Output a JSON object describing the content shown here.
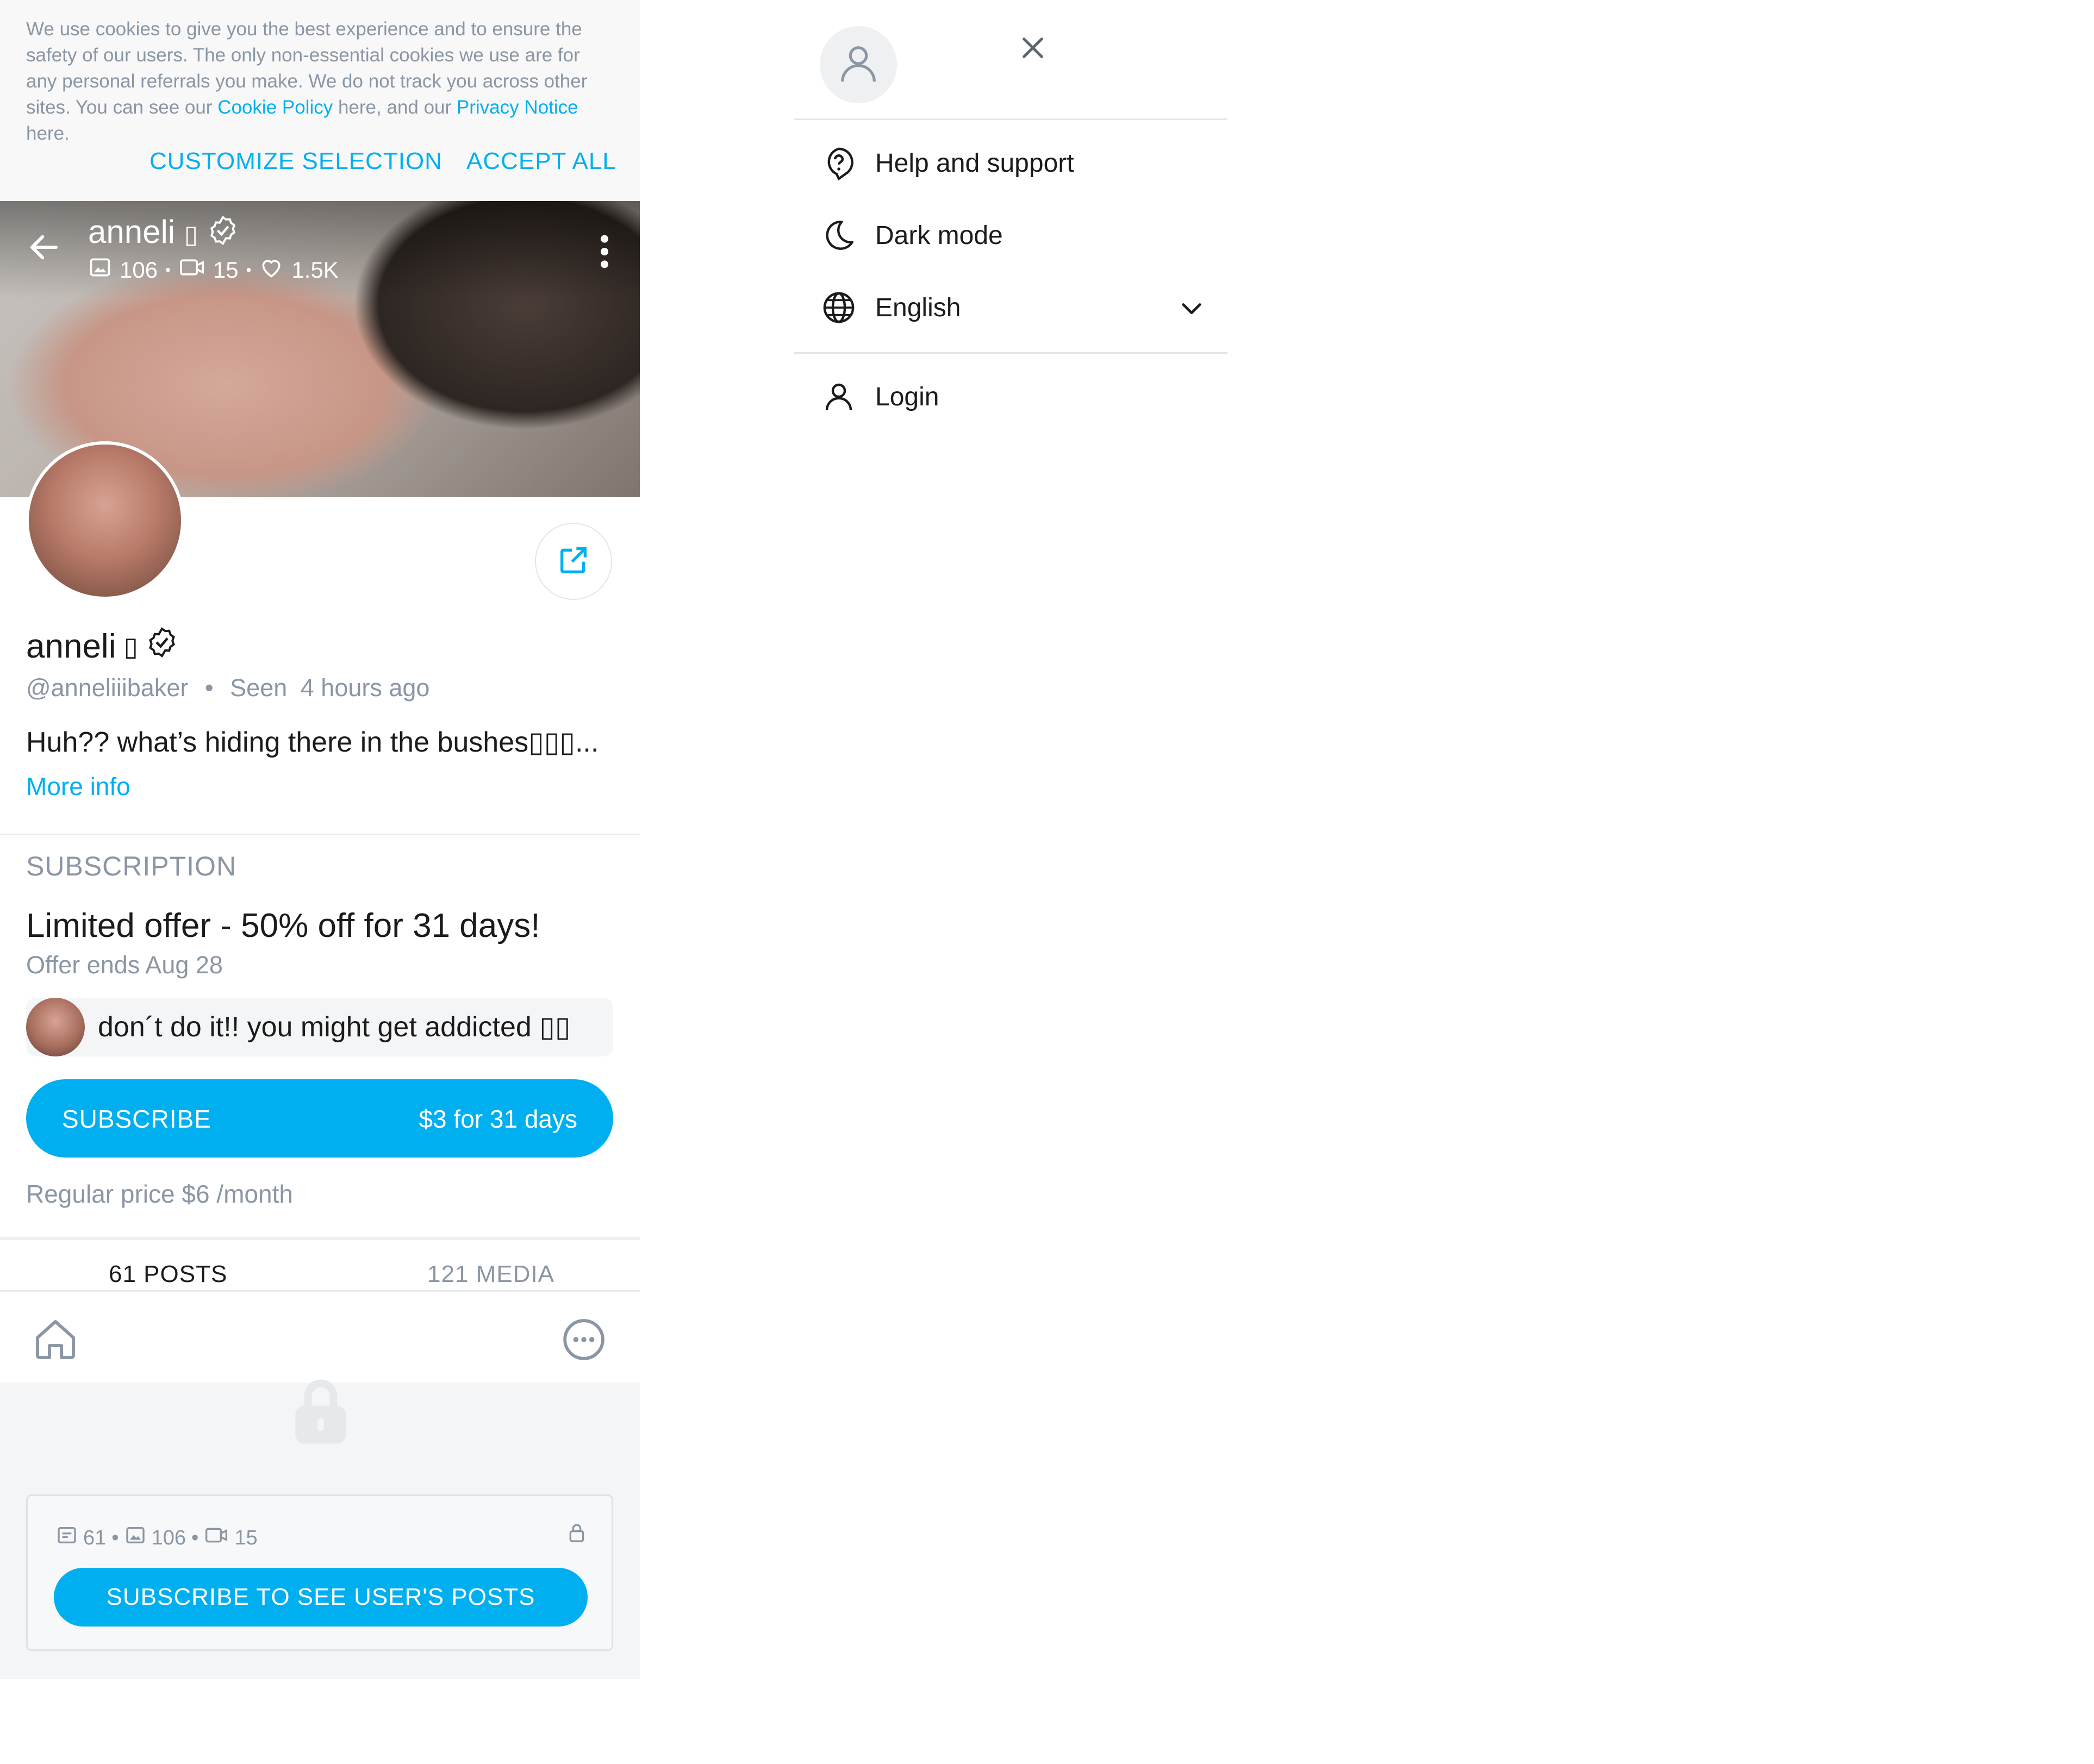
{
  "cookie_banner": {
    "text_part1": "We use cookies to give you the best experience and to ensure the safety of our users. The only non-essential cookies we use are for any personal referrals you make. We do not track you across other sites. You can see our ",
    "cookie_policy_link": "Cookie Policy",
    "text_part2": " here, and our ",
    "privacy_notice_link": "Privacy Notice",
    "text_part3": " here.",
    "customize_label": "CUSTOMIZE SELECTION",
    "accept_label": "ACCEPT ALL"
  },
  "cover": {
    "name": "anneli",
    "name_glyph": "▯",
    "photos": "106",
    "videos": "15",
    "likes": "1.5K"
  },
  "profile": {
    "name": "anneli",
    "name_glyph": "▯",
    "handle": "@anneliiibaker",
    "seen_label": "Seen",
    "seen_time": "4 hours ago",
    "bio": "Huh?? what’s hiding there in the bushes▯▯▯...",
    "more_info": "More info"
  },
  "subscription": {
    "heading": "SUBSCRIPTION",
    "offer_title": "Limited offer - 50% off for 31 days!",
    "offer_ends": "Offer ends Aug 28",
    "message": "don´t do it!! you might get addicted ▯▯",
    "subscribe_label": "SUBSCRIBE",
    "subscribe_price": "$3 for 31 days",
    "regular_price": "Regular price $6 /month"
  },
  "tabs": [
    {
      "label": "61 POSTS",
      "active": true
    },
    {
      "label": "121 MEDIA",
      "active": false
    }
  ],
  "locked": {
    "posts": "61",
    "photos": "106",
    "videos": "15",
    "button_label": "SUBSCRIBE TO SEE USER'S POSTS"
  },
  "menu": {
    "items": [
      {
        "label": "Help and support",
        "icon": "help-icon"
      },
      {
        "label": "Dark mode",
        "icon": "moon-icon"
      },
      {
        "label": "English",
        "icon": "globe-icon"
      },
      {
        "label": "Login",
        "icon": "user-icon"
      }
    ]
  },
  "colors": {
    "accent": "#00aff0",
    "muted_text": "#8a96a3",
    "text": "#1b1b1b"
  }
}
